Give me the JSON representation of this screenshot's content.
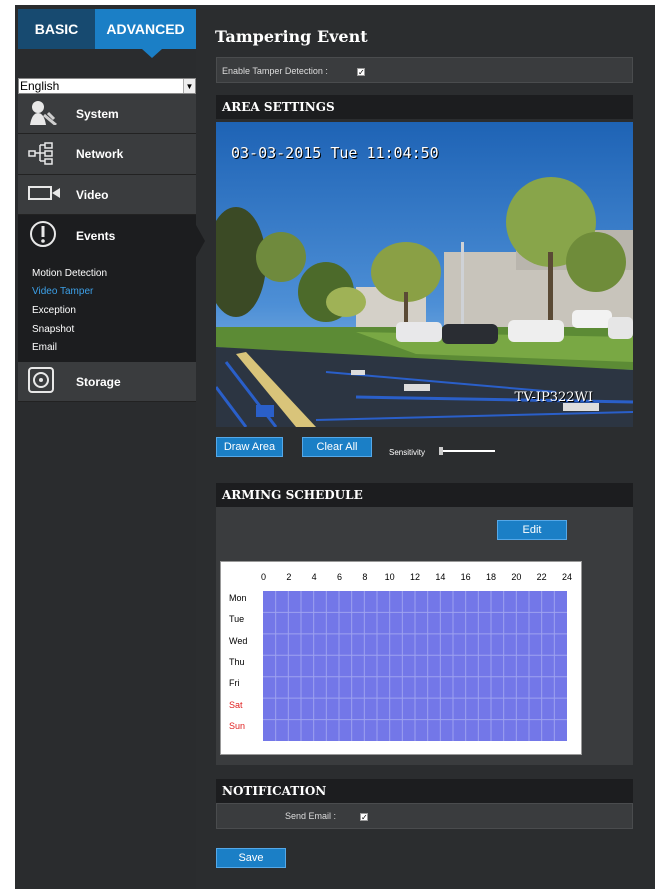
{
  "sidebar": {
    "tabs": {
      "basic": "BASIC",
      "advanced": "ADVANCED"
    },
    "language": "English",
    "menu": {
      "system": "System",
      "network": "Network",
      "video": "Video",
      "events": "Events",
      "storage": "Storage"
    },
    "events_sub": [
      "Motion Detection",
      "Video Tamper",
      "Exception",
      "Snapshot",
      "Email"
    ],
    "active_sub": "Video Tamper"
  },
  "page": {
    "title": "Tampering Event",
    "enable_label": "Enable Tamper Detection :",
    "enable_checked": true
  },
  "area": {
    "header": "AREA SETTINGS",
    "timestamp": "03-03-2015 Tue 11:04:50",
    "camera_id": "TV-IP322WI",
    "draw_area": "Draw Area",
    "clear_all": "Clear All",
    "sensitivity_label": "Sensitivity",
    "sensitivity": 0
  },
  "schedule": {
    "header": "ARMING SCHEDULE",
    "edit": "Edit",
    "hours": [
      "0",
      "2",
      "4",
      "6",
      "8",
      "10",
      "12",
      "14",
      "16",
      "18",
      "20",
      "22",
      "24"
    ],
    "days": [
      "Mon",
      "Tue",
      "Wed",
      "Thu",
      "Fri",
      "Sat",
      "Sun"
    ],
    "weekend_color": "#e02020",
    "armed_color": "#7377e8"
  },
  "notification": {
    "header": "NOTIFICATION",
    "send_email_label": "Send Email :",
    "send_email_checked": true
  },
  "save_label": "Save",
  "colors": {
    "accent": "#1b7fc6",
    "active_link": "#3ca0e8"
  }
}
